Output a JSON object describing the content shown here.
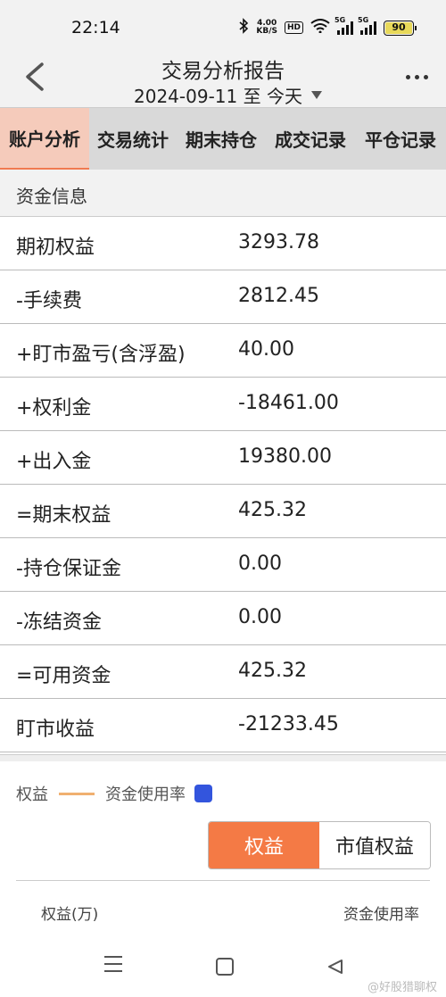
{
  "status_bar": {
    "time": "22:14",
    "net_speed_value": "4.00",
    "net_speed_unit": "KB/S",
    "hd_label": "HD",
    "signal1_label": "5G",
    "signal2_label": "5G",
    "battery": "90",
    "icons": [
      "bluetooth-icon",
      "wifi-icon",
      "signal-icon",
      "battery-icon"
    ]
  },
  "header": {
    "title": "交易分析报告",
    "date_range": "2024-09-11 至 今天"
  },
  "tabs": [
    {
      "label": "账户分析",
      "active": true
    },
    {
      "label": "交易统计",
      "active": false
    },
    {
      "label": "期末持仓",
      "active": false
    },
    {
      "label": "成交记录",
      "active": false
    },
    {
      "label": "平仓记录",
      "active": false
    }
  ],
  "section": {
    "title": "资金信息"
  },
  "funds": [
    {
      "label": "期初权益",
      "value": "3293.78"
    },
    {
      "label": "-手续费",
      "value": "2812.45"
    },
    {
      "label": "+盯市盈亏(含浮盈)",
      "value": "40.00"
    },
    {
      "label": "+权利金",
      "value": "-18461.00"
    },
    {
      "label": "+出入金",
      "value": "19380.00"
    },
    {
      "label": "=期末权益",
      "value": "425.32"
    },
    {
      "label": "-持仓保证金",
      "value": "0.00"
    },
    {
      "label": "-冻结资金",
      "value": "0.00"
    },
    {
      "label": "=可用资金",
      "value": "425.32"
    },
    {
      "label": "盯市收益",
      "value": "-21233.45"
    }
  ],
  "chart": {
    "legend_equity": "权益",
    "legend_usage": "资金使用率",
    "colors": {
      "equity_line": "#f0b070",
      "usage_box": "#3355dd",
      "accent": "#f47a45"
    },
    "toggle_equity": "权益",
    "toggle_market": "市值权益",
    "left_axis_label": "权益(万)",
    "right_axis_label": "资金使用率"
  },
  "watermark": "@好股猎聊权"
}
